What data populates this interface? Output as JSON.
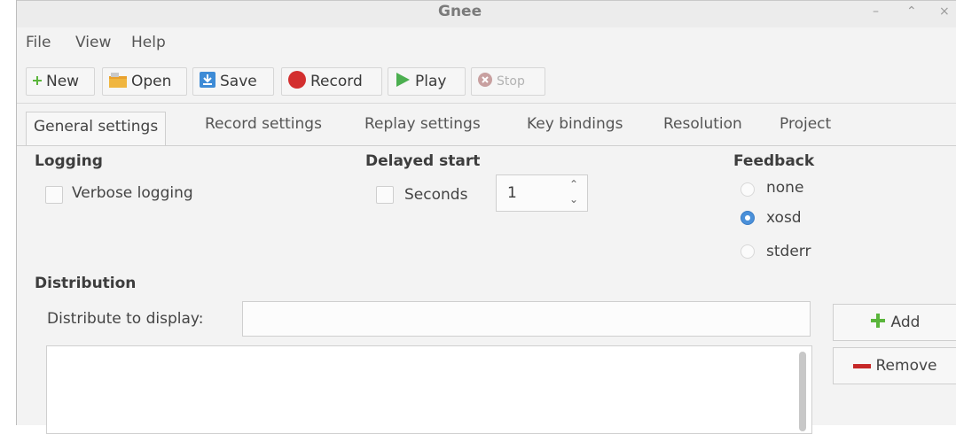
{
  "window": {
    "title": "Gnee"
  },
  "menu": {
    "items": [
      "File",
      "View",
      "Help"
    ]
  },
  "toolbar": {
    "new": "New",
    "open": "Open",
    "save": "Save",
    "record": "Record",
    "play": "Play",
    "stop": "Stop"
  },
  "tabs": [
    "General settings",
    "Record settings",
    "Replay settings",
    "Key bindings",
    "Resolution",
    "Project"
  ],
  "logging": {
    "title": "Logging",
    "verbose_label": "Verbose logging"
  },
  "delayed_start": {
    "title": "Delayed start",
    "seconds_label": "Seconds",
    "seconds_value": "1"
  },
  "feedback": {
    "title": "Feedback",
    "options": [
      "none",
      "xosd",
      "stderr"
    ],
    "selected": "xosd"
  },
  "distribution": {
    "title": "Distribution",
    "display_label": "Distribute to display:",
    "display_value": "",
    "add_label": "Add",
    "remove_label": "Remove"
  },
  "colors": {
    "accent": "#4a90d9",
    "record": "#d32f2f",
    "play": "#4caf50",
    "add": "#4caf50",
    "remove": "#c62828"
  },
  "icons": {
    "new": "plus-icon",
    "open": "folder-icon",
    "save": "save-icon",
    "record": "record-icon",
    "play": "play-icon",
    "stop": "stop-icon"
  }
}
